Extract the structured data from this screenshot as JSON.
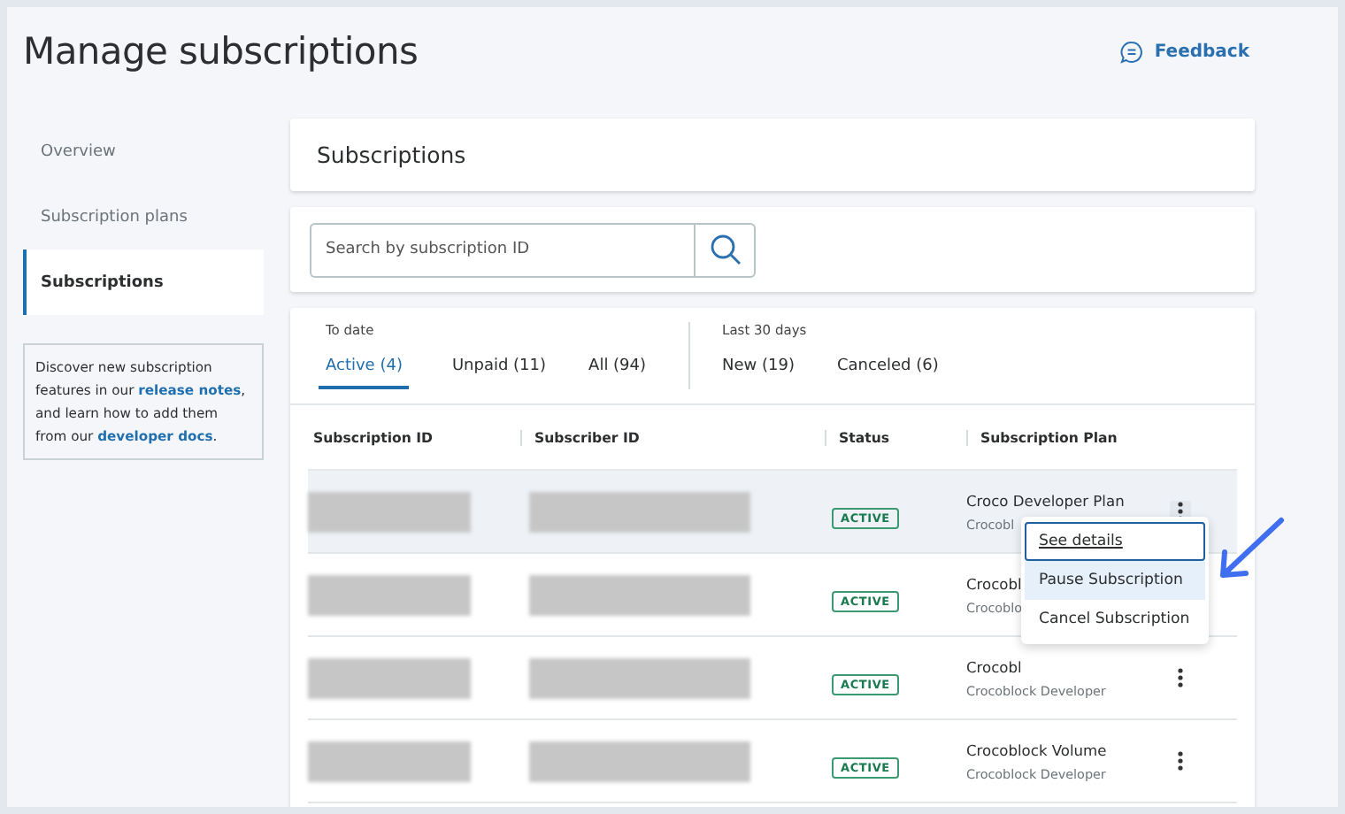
{
  "page": {
    "title": "Manage subscriptions",
    "feedback": "Feedback"
  },
  "sidebar": {
    "items": [
      {
        "label": "Overview",
        "selected": false
      },
      {
        "label": "Subscription plans",
        "selected": false
      },
      {
        "label": "Subscriptions",
        "selected": true
      }
    ],
    "info": {
      "text": "Discover new subscription features in our",
      "link1": "release notes",
      "middle": ", and learn how to add them from our",
      "link2": "developer docs",
      "end": "."
    }
  },
  "header_card": {
    "title": "Subscriptions"
  },
  "search": {
    "placeholder": "Search by subscription ID"
  },
  "filters": {
    "groups": [
      {
        "label": "To date",
        "tabs": [
          {
            "label": "Active (4)",
            "selected": true
          },
          {
            "label": "Unpaid (11)",
            "selected": false
          },
          {
            "label": "All (94)",
            "selected": false
          }
        ]
      },
      {
        "label": "Last 30 days",
        "tabs": [
          {
            "label": "New (19)",
            "selected": false
          },
          {
            "label": "Canceled (6)",
            "selected": false
          }
        ]
      }
    ]
  },
  "table": {
    "columns": [
      "Subscription ID",
      "Subscriber ID",
      "Status",
      "Subscription Plan"
    ],
    "rows": [
      {
        "status": "ACTIVE",
        "plan": "Croco Developer Plan",
        "plan_sub": "Crocobl",
        "highlighted": true,
        "menu_open": true
      },
      {
        "status": "ACTIVE",
        "plan": "Crocobl",
        "plan_sub": "Crocoblo",
        "highlighted": false,
        "menu_open": false
      },
      {
        "status": "ACTIVE",
        "plan": "Crocobl",
        "plan_sub": "Crocoblock Developer",
        "highlighted": false,
        "menu_open": false
      },
      {
        "status": "ACTIVE",
        "plan": "Crocoblock Volume",
        "plan_sub": "Crocoblock Developer",
        "highlighted": false,
        "menu_open": false
      }
    ]
  },
  "menu": {
    "items": [
      {
        "label": "See details",
        "focused": true,
        "hovered": false
      },
      {
        "label": "Pause Subscription",
        "focused": false,
        "hovered": true
      },
      {
        "label": "Cancel Subscription",
        "focused": false,
        "hovered": false
      }
    ]
  }
}
